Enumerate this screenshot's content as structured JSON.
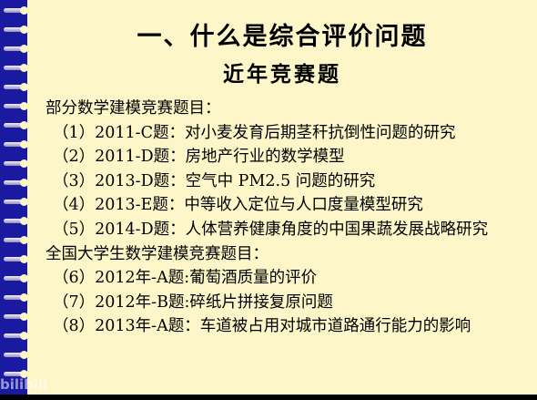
{
  "slide": {
    "title": "一、什么是综合评价问题",
    "subtitle": "近年竞赛题",
    "lines": [
      "部分数学建模竞赛题目：",
      "（1）2011-C题：对小麦发育后期茎秆抗倒性问题的研究",
      "（2）2011-D题：房地产行业的数学模型",
      "（3）2013-D题：空气中  PM2.5 问题的研究",
      "（4）2013-E题：中等收入定位与人口度量模型研究",
      "（5）2014-D题：人体营养健康角度的中国果蔬发展战略研究",
      "全国大学生数学建模竞赛题目：",
      "（6）2012年-A题:葡萄酒质量的评价",
      "（7）2012年-B题:碎纸片拼接复原问题",
      "（8）2013年-A题：车道被占用对城市道路通行能力的影响"
    ]
  },
  "watermark": {
    "text": "bilibili"
  }
}
